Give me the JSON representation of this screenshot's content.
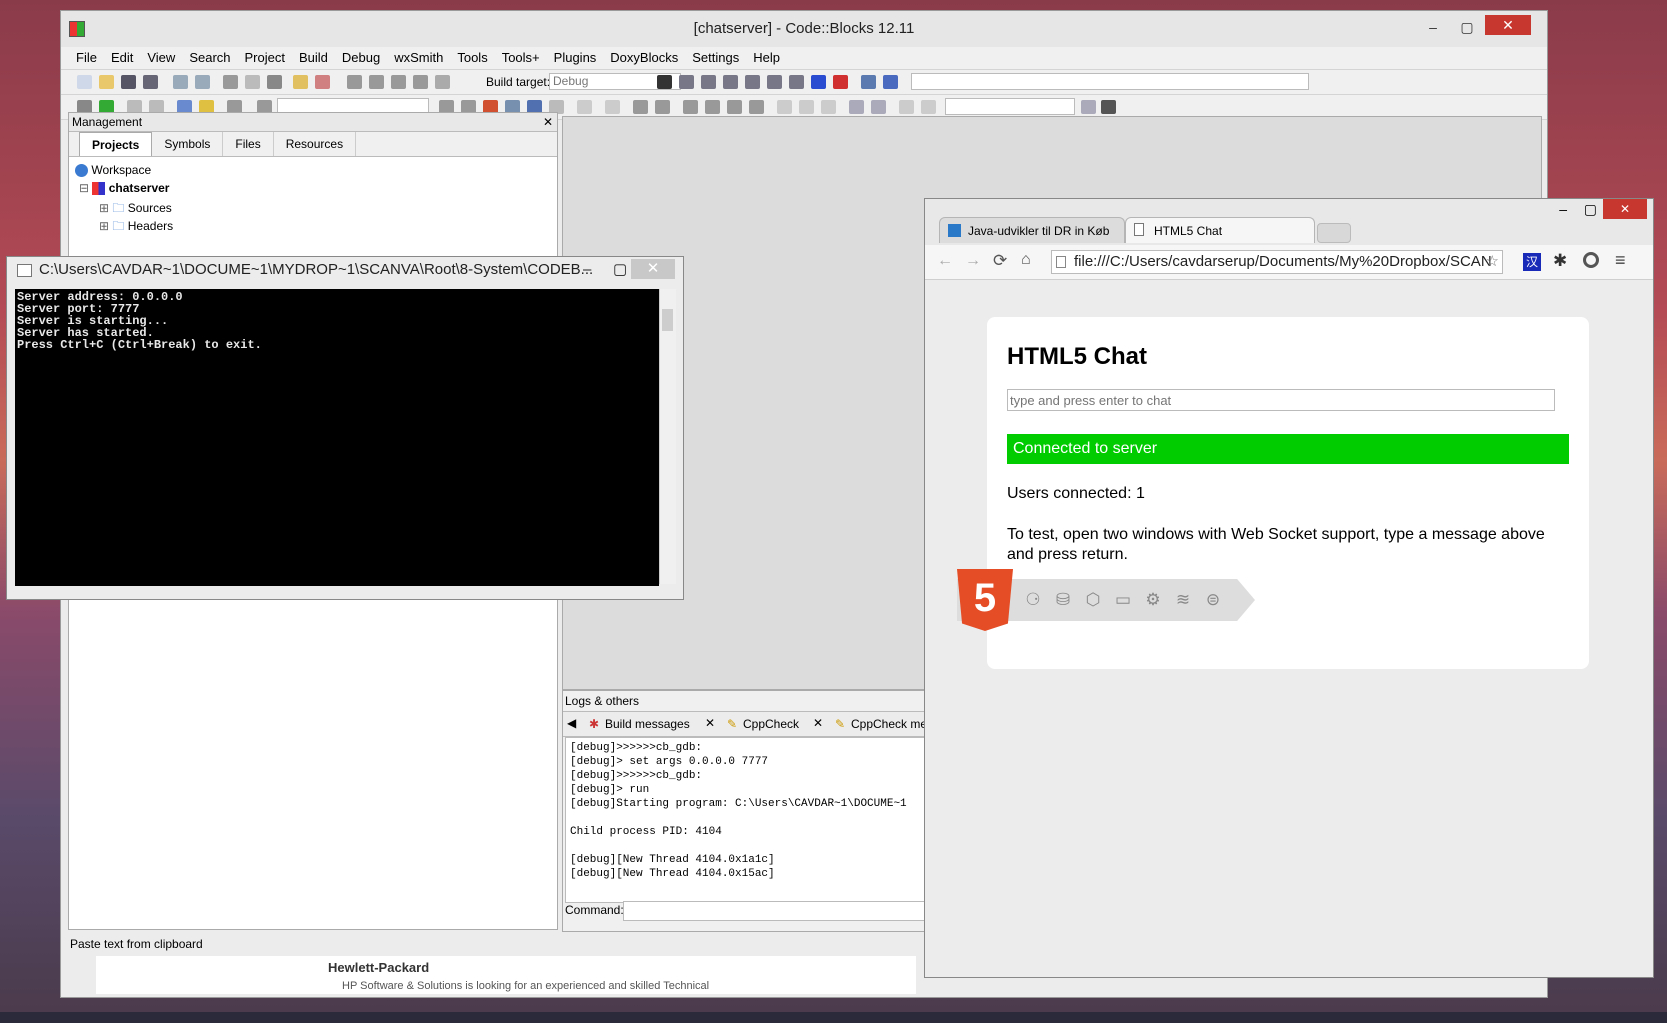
{
  "codeblocks": {
    "title": "[chatserver] - Code::Blocks 12.11",
    "menu": [
      "File",
      "Edit",
      "View",
      "Search",
      "Project",
      "Build",
      "Debug",
      "wxSmith",
      "Tools",
      "Tools+",
      "Plugins",
      "DoxyBlocks",
      "Settings",
      "Help"
    ],
    "build_target_label": "Build target:",
    "build_target_value": "Debug",
    "management": {
      "title": "Management",
      "tabs": [
        "Projects",
        "Symbols",
        "Files",
        "Resources"
      ],
      "tree": {
        "workspace": "Workspace",
        "project": "chatserver",
        "folders": [
          "Sources",
          "Headers"
        ]
      }
    },
    "logs": {
      "title": "Logs & others",
      "tabs": [
        "Build messages",
        "CppCheck",
        "CppCheck me"
      ],
      "lines": "[debug]>>>>>>cb_gdb:\n[debug]> set args 0.0.0.0 7777\n[debug]>>>>>>cb_gdb:\n[debug]> run\n[debug]Starting program: C:\\Users\\CAVDAR~1\\DOCUME~1\n\nChild process PID: 4104\n\n[debug][New Thread 4104.0x1a1c]\n[debug][New Thread 4104.0x15ac]",
      "command_label": "Command:"
    },
    "status": "Paste text from clipboard"
  },
  "console": {
    "title": "C:\\Users\\CAVDAR~1\\DOCUME~1\\MYDROP~1\\SCANVA\\Root\\8-System\\CODEB...",
    "output": "Server address: 0.0.0.0\nServer port: 7777\nServer is starting...\nServer has started.\nPress Ctrl+C (Ctrl+Break) to exit."
  },
  "browser": {
    "tabs": [
      {
        "label": "Java-udvikler til DR in Køb"
      },
      {
        "label": "HTML5 Chat"
      }
    ],
    "url": "file:///C:/Users/cavdarserup/Documents/My%20Dropbox/SCAN",
    "page": {
      "title": "HTML5 Chat",
      "input_placeholder": "type and press enter to chat",
      "status": "Connected to server",
      "status_color": "#00cc00",
      "users": "Users connected: 1",
      "instructions": "To test, open two windows with Web Socket support, type a message above and press return.",
      "badge": "5"
    }
  },
  "behind": {
    "company": "Hewlett-Packard",
    "snippet": "HP Software & Solutions is looking for an experienced and skilled Technical"
  }
}
